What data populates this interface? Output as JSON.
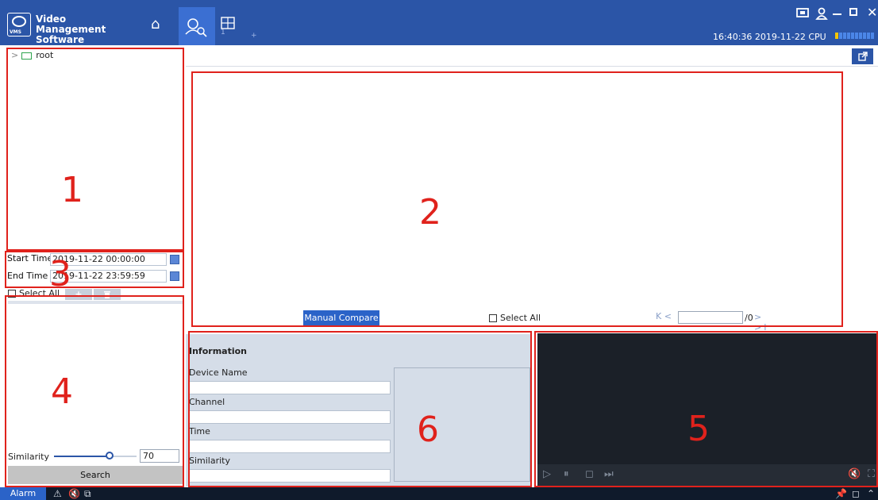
{
  "app": {
    "name": "Video Management Software",
    "logo_text": "VMS"
  },
  "topbar": {
    "tab_numbers": [
      "1",
      "+"
    ],
    "clock": "16:40:36 2019-11-22 CPU",
    "window_controls": [
      "screen-icon",
      "user-icon",
      "minimize-icon",
      "maximize-icon",
      "close-icon"
    ]
  },
  "tree": {
    "root_label": "root"
  },
  "time": {
    "start_label": "Start Time",
    "start_value": "2019-11-22 00:00:00",
    "end_label": "End Time",
    "end_value": "2019-11-22 23:59:59"
  },
  "left_list": {
    "select_all": "Select All",
    "add_label": "+",
    "delete_label": "🗑"
  },
  "similarity": {
    "label": "Similarity",
    "value": "70",
    "level": 0.7
  },
  "search_button": "Search",
  "compare": {
    "manual_compare": "Manual Compare",
    "select_all": "Select All",
    "pager_first": "K <",
    "pager_total": "/0",
    "pager_next": "> >I"
  },
  "info": {
    "title": "Information",
    "fields": [
      "Device Name",
      "Channel",
      "Time",
      "Similarity"
    ]
  },
  "statusbar": {
    "alarm": "Alarm"
  },
  "annotations": [
    "1",
    "2",
    "3",
    "4",
    "5",
    "6"
  ],
  "colors": {
    "primary": "#2b55a7",
    "accent": "#2b63c8",
    "annotation": "#e0221c",
    "video_bg": "#1b2028"
  }
}
